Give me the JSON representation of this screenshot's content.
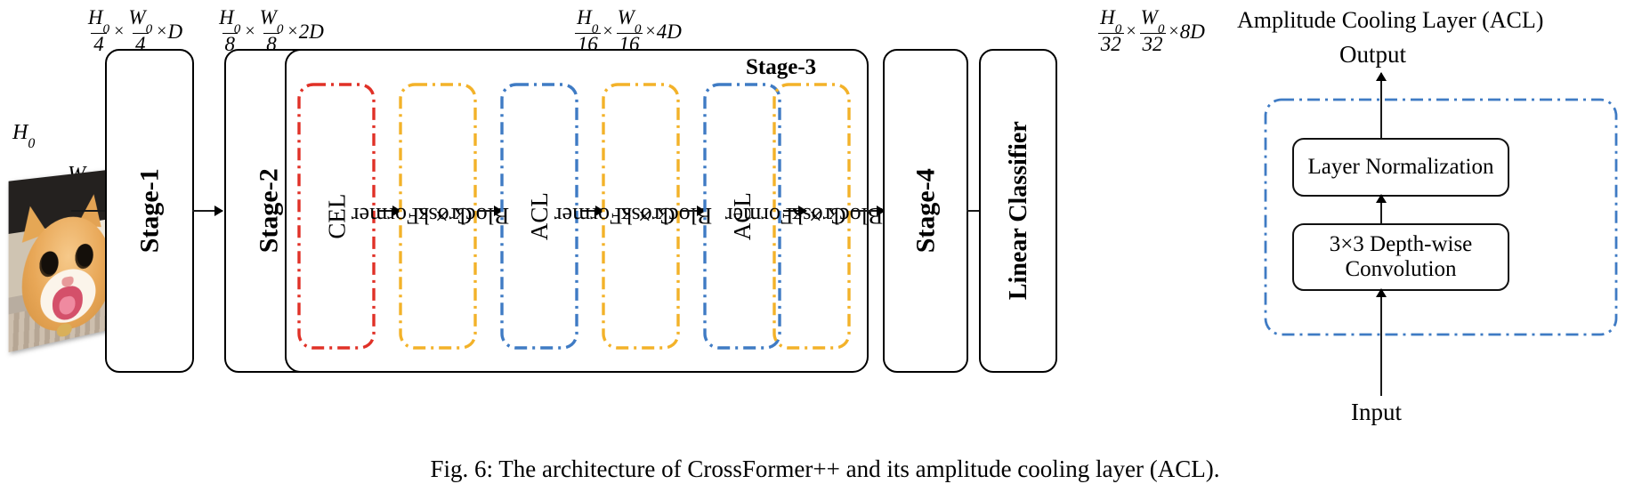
{
  "figure": {
    "caption": "Fig. 6: The architecture of CrossFormer++ and its amplitude cooling layer (ACL)."
  },
  "colors": {
    "cel_border": "#E03127",
    "crossformer_border": "#F3B229",
    "acl_border": "#3F7BC4",
    "stage_border": "#000000",
    "arrow": "#1a1a1a"
  },
  "input": {
    "height_label": "H",
    "height_sub": "0",
    "width_label": "W",
    "width_sub": "0",
    "image_alt": "cat-photo"
  },
  "dimension_labels": [
    {
      "id": "after-stage1",
      "num1": "H",
      "sub1": "0",
      "den1": "4",
      "num2": "W",
      "sub2": "0",
      "den2": "4",
      "mult": "D",
      "times": "×"
    },
    {
      "id": "after-stage2",
      "num1": "H",
      "sub1": "0",
      "den1": "8",
      "num2": "W",
      "sub2": "0",
      "den2": "8",
      "mult": "2D",
      "times": "×"
    },
    {
      "id": "after-stage3",
      "num1": "H",
      "sub1": "0",
      "den1": "16",
      "num2": "W",
      "sub2": "0",
      "den2": "16",
      "mult": "4D",
      "times": "×"
    },
    {
      "id": "after-stage4",
      "num1": "H",
      "sub1": "0",
      "den1": "32",
      "num2": "W",
      "sub2": "0",
      "den2": "32",
      "mult": "8D",
      "times": "×"
    }
  ],
  "pipeline": {
    "stage1": "Stage-1",
    "stage2": "Stage-2",
    "stage3_tag": "Stage-3",
    "stage4": "Stage-4",
    "classifier": "Linear Classifier"
  },
  "stage3_blocks": [
    {
      "id": "cel",
      "label": "CEL",
      "label_line2": "",
      "kind": "cel"
    },
    {
      "id": "cfb1",
      "label": "CrossFormer",
      "label_line2": "Block × k",
      "kind": "crossformer"
    },
    {
      "id": "acl1",
      "label": "ACL",
      "label_line2": "",
      "kind": "acl"
    },
    {
      "id": "cfb2",
      "label": "CrossFormer",
      "label_line2": "Block × k",
      "kind": "crossformer"
    },
    {
      "id": "acl2",
      "label": "ACL",
      "label_line2": "",
      "kind": "acl"
    },
    {
      "id": "cfb3",
      "label": "CrossFormer",
      "label_line2": "Block × k",
      "kind": "crossformer"
    }
  ],
  "acl_panel": {
    "title": "Amplitude Cooling Layer (ACL)",
    "output_label": "Output",
    "input_label": "Input",
    "layers": [
      {
        "id": "layernorm",
        "line1": "Layer Normalization",
        "line2": ""
      },
      {
        "id": "dwconv",
        "line1": "3×3  Depth-wise",
        "line2": "Convolution"
      }
    ]
  }
}
